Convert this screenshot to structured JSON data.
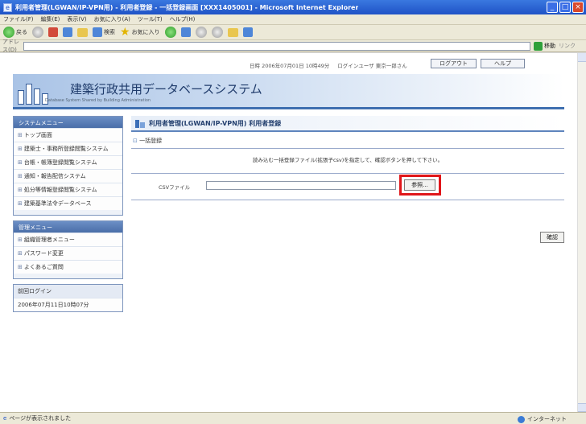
{
  "window": {
    "title": "利用者管理(LGWAN/IP-VPN用) - 利用者登録 - 一括登録画面 [XXX1405001] - Microsoft Internet Explorer",
    "icon": "ie-icon"
  },
  "menubar": [
    "ファイル(F)",
    "編集(E)",
    "表示(V)",
    "お気に入り(A)",
    "ツール(T)",
    "ヘルプ(H)"
  ],
  "toolbar": {
    "back": "戻る",
    "search": "検索",
    "favorites": "お気に入り"
  },
  "addressbar": {
    "label": "アドレス(D)",
    "go": "移動",
    "links": "リンク"
  },
  "page": {
    "sysline": {
      "date": "日時 2006年07月01日 10時49分",
      "user": "ログインユーザ 東京一郎さん"
    },
    "logout_button": "ログアウト",
    "help_button": "ヘルプ",
    "site_title": "建築行政共用データベースシステム",
    "site_subtitle": "Database System Shared by Building Administration",
    "title": "利用者管理(LGWAN/IP-VPN用) 利用者登録",
    "section": "一括登録",
    "instruction": "読み込む一括登録ファイル(拡張子csv)を指定して、確認ボタンを押して下さい。",
    "file_label": "CSVファイル",
    "browse_button": "参照...",
    "confirm_button": "確認"
  },
  "sidebar": {
    "system_menu": {
      "heading": "システムメニュー",
      "items": [
        "トップ画面",
        "建築士・事務所登録閲覧システム",
        "台帳・帳簿登録閲覧システム",
        "通知・報告配信システム",
        "処分等情報登録閲覧システム",
        "建築基準法令データベース"
      ]
    },
    "admin_menu": {
      "heading": "管理メニュー",
      "items": [
        "組織管理者メニュー",
        "パスワード変更",
        "よくあるご質問"
      ]
    },
    "login_box": {
      "heading": "前回ログイン",
      "value": "2006年07月11日10時07分"
    }
  },
  "statusbar": {
    "text": "ページが表示されました",
    "zone": "インターネット"
  },
  "colors": {
    "accent": "#3f6fb0",
    "highlight": "#e0161a"
  }
}
